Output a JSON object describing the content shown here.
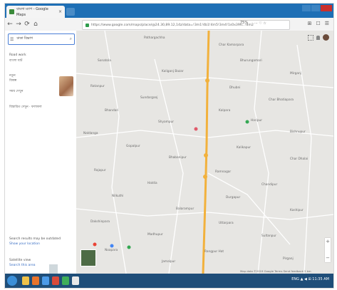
{
  "browser": {
    "tab_title": "বাংলা ম্যাপ - Google Maps",
    "tab_close": "×",
    "nav": {
      "back": "←",
      "forward": "→",
      "reload": "⟳",
      "home": "⌂"
    },
    "url": "https://www.google.com/maps/place/@24.30,89.12,14z/data=!3m1!4b1!4m5!3m4!1s0x39fc..!8m2",
    "zoom": "75%",
    "ext_label": "··· ♡ ☆",
    "tools": [
      "⊞",
      "☐",
      "☰"
    ]
  },
  "panel": {
    "search_value": "ঢাকা বিভাগ",
    "search_menu_icon": "menu-icon",
    "search_icon": "search-icon",
    "line1": "Road work",
    "line2": "বাংলা ঘাট",
    "line3": "নতুন",
    "line4": "বিকল্প",
    "line5": "সময় দেখুন",
    "line6": "বিস্তারিত দেখুন · ফলাফল",
    "footer1": "Search results may be outdated",
    "footer2": "Show your location",
    "footer3": "Satellite view",
    "footer4": "Search this area"
  },
  "map": {
    "labels": [
      "Pathargachha",
      "Char Kamarpara",
      "Sonatola",
      "Bhurungamari",
      "Kaliganj Bazar",
      "Mirganj",
      "Ratanpur",
      "Dhubni",
      "Sundarganj",
      "Char Bhatiapara",
      "Bhandari",
      "Kalpara",
      "Shyampur",
      "Haripur",
      "Naldanga",
      "Bishnupur",
      "Gopalpur",
      "Kalikapur",
      "Bhabanipur",
      "Char Dhalai",
      "Rajapur",
      "Ramnagar",
      "Haldia",
      "Chandipur",
      "Nilkuthi",
      "Durgapur",
      "Balarampur",
      "Kashipur",
      "Dakshinpara",
      "Uttarpara",
      "Madhupur",
      "Sultanpur",
      "Noapara",
      "Rangpur Hat",
      "Jamalpur",
      "Pirganj"
    ],
    "footer": "Map data ©2019 Google  Terms  Send feedback  2 km",
    "zoom_in": "+",
    "zoom_out": "−",
    "colors": {
      "land": "#e7e6e3",
      "highway": "#f2b13c",
      "road": "#ffffff",
      "accent": "#4a7fd6"
    }
  },
  "taskbar": {
    "tray": "ENG  ▲ ◀ ⊞  11:35 AM"
  }
}
